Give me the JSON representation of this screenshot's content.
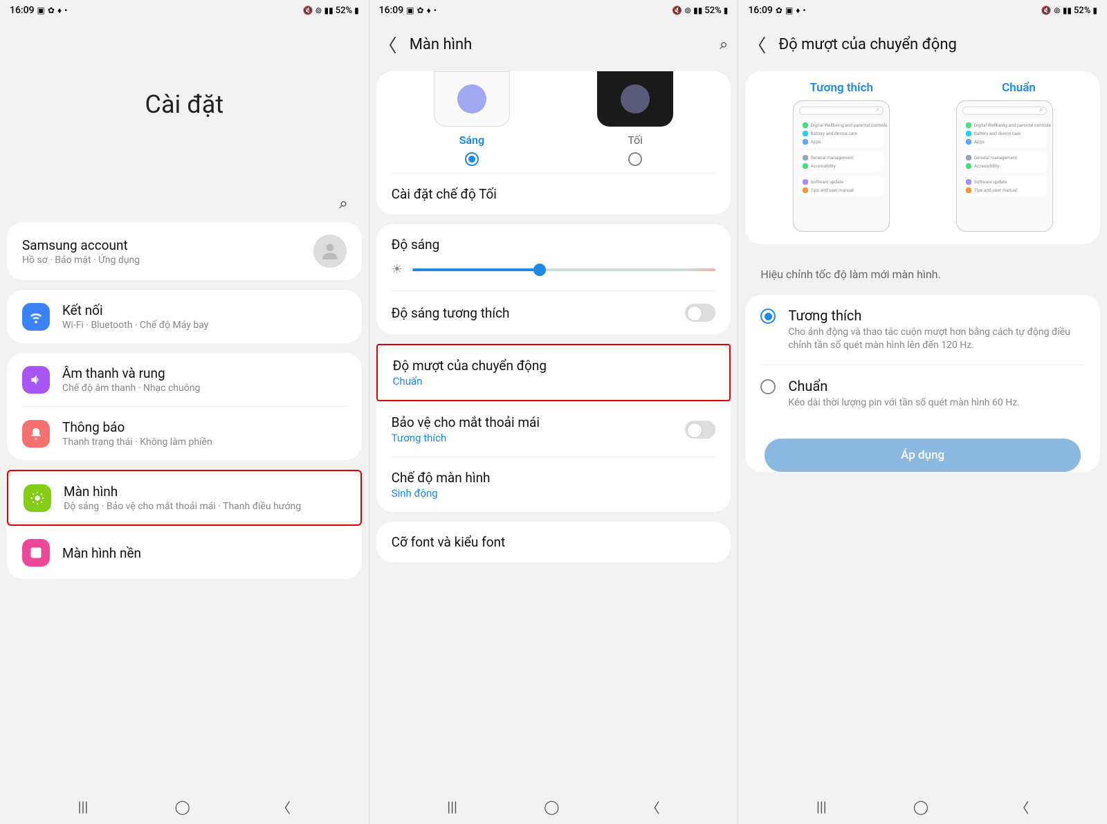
{
  "status": {
    "time": "16:09",
    "battery": "52%"
  },
  "p1": {
    "title": "Cài đặt",
    "account": {
      "title": "Samsung account",
      "sub": "Hồ sơ · Bảo mật · Ứng dụng"
    },
    "items": [
      {
        "title": "Kết nối",
        "sub": "Wi-Fi · Bluetooth · Chế độ Máy bay"
      },
      {
        "title": "Âm thanh và rung",
        "sub": "Chế độ âm thanh · Nhạc chuông"
      },
      {
        "title": "Thông báo",
        "sub": "Thanh trạng thái · Không làm phiền"
      },
      {
        "title": "Màn hình",
        "sub": "Độ sáng · Bảo vệ cho mắt thoải mái · Thanh điều hướng"
      },
      {
        "title": "Màn hình nền",
        "sub": ""
      }
    ]
  },
  "p2": {
    "title": "Màn hình",
    "light": "Sáng",
    "dark": "Tối",
    "dark_settings": "Cài đặt chế độ Tối",
    "brightness": "Độ sáng",
    "adaptive": "Độ sáng tương thích",
    "motion": {
      "title": "Độ mượt của chuyển động",
      "value": "Chuẩn"
    },
    "eye": {
      "title": "Bảo vệ cho mắt thoải mái",
      "value": "Tương thích"
    },
    "mode": {
      "title": "Chế độ màn hình",
      "value": "Sinh động"
    },
    "font": "Cỡ font và kiểu font"
  },
  "p3": {
    "title": "Độ mượt của chuyển động",
    "tab1": "Tương thích",
    "tab2": "Chuẩn",
    "mini": [
      "Digital Wellbeing and parental controls",
      "Battery and device care",
      "Apps",
      "General management",
      "Accessibility",
      "Software update",
      "Tips and user manual"
    ],
    "info": "Hiệu chỉnh tốc độ làm mới màn hình.",
    "opt1": {
      "title": "Tương thích",
      "desc": "Cho ảnh động và thao tác cuộn mượt hơn bằng cách tự động điều chỉnh tần số quét màn hình lên đến 120 Hz."
    },
    "opt2": {
      "title": "Chuẩn",
      "desc": "Kéo dài thời lượng pin với tần số quét màn hình 60 Hz."
    },
    "apply": "Áp dụng"
  }
}
